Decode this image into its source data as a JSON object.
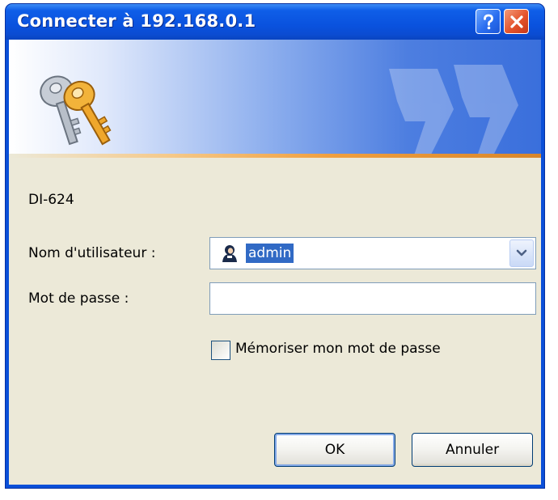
{
  "window": {
    "title": "Connecter à 192.168.0.1"
  },
  "titlebar": {
    "help_label": "?"
  },
  "dialog": {
    "device_name": "DI-624",
    "username_label": "Nom d'utilisateur :",
    "username_value": "admin",
    "password_label": "Mot de passe :",
    "password_value": "",
    "remember_label": "Mémoriser mon mot de passe",
    "remember_checked": false,
    "ok_label": "OK",
    "cancel_label": "Annuler"
  },
  "icons": {
    "banner": "keys-icon",
    "user": "user-icon",
    "dropdown": "chevron-down-icon",
    "help": "help-icon",
    "close": "close-icon"
  },
  "colors": {
    "titlebar": "#0a52de",
    "dialog_bg": "#ece9d8",
    "selection": "#316ac5",
    "close_button": "#e4532b"
  }
}
